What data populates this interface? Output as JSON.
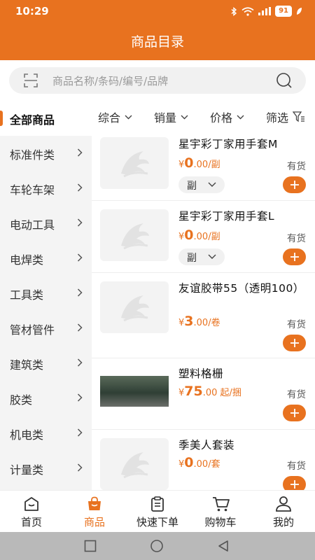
{
  "status": {
    "time": "10:29",
    "battery": "91"
  },
  "header": {
    "title": "商品目录"
  },
  "search": {
    "placeholder": "商品名称/条码/编号/品牌"
  },
  "sidebar": {
    "items": [
      {
        "label": "全部商品",
        "active": true
      },
      {
        "label": "标准件类"
      },
      {
        "label": "车轮车架"
      },
      {
        "label": "电动工具"
      },
      {
        "label": "电焊类"
      },
      {
        "label": "工具类"
      },
      {
        "label": "管材管件"
      },
      {
        "label": "建筑类"
      },
      {
        "label": "胶类"
      },
      {
        "label": "机电类"
      },
      {
        "label": "计量类"
      }
    ]
  },
  "sort": {
    "composite": "综合",
    "sales": "销量",
    "price": "价格",
    "filter": "筛选"
  },
  "products": [
    {
      "name": "星宇彩丁家用手套M",
      "currency": "¥",
      "price_int": "0",
      "price_dec": ".00",
      "unit": "/副",
      "stock": "有货",
      "unit_select": "副"
    },
    {
      "name": "星宇彩丁家用手套L",
      "currency": "¥",
      "price_int": "0",
      "price_dec": ".00",
      "unit": "/副",
      "stock": "有货",
      "unit_select": "副"
    },
    {
      "name": "友谊胶带55（透明100）",
      "currency": "¥",
      "price_int": "3",
      "price_dec": ".00",
      "unit": "/卷",
      "stock": "有货"
    },
    {
      "name": "塑料格栅",
      "currency": "¥",
      "price_int": "75",
      "price_dec": ".00",
      "unit": " 起/捆",
      "stock": "有货"
    },
    {
      "name": "季美人套装",
      "currency": "¥",
      "price_int": "0",
      "price_dec": ".00",
      "unit": "/套",
      "stock": "有货"
    }
  ],
  "tabs": [
    {
      "label": "首页",
      "icon": "home-icon"
    },
    {
      "label": "商品",
      "icon": "bag-icon",
      "active": true
    },
    {
      "label": "快速下单",
      "icon": "clipboard-icon"
    },
    {
      "label": "购物车",
      "icon": "cart-icon"
    },
    {
      "label": "我的",
      "icon": "user-icon"
    }
  ],
  "colors": {
    "accent": "#e8721f",
    "sidebar_bg": "#f4f4f4",
    "navbar_bg": "#b9b9b9"
  }
}
